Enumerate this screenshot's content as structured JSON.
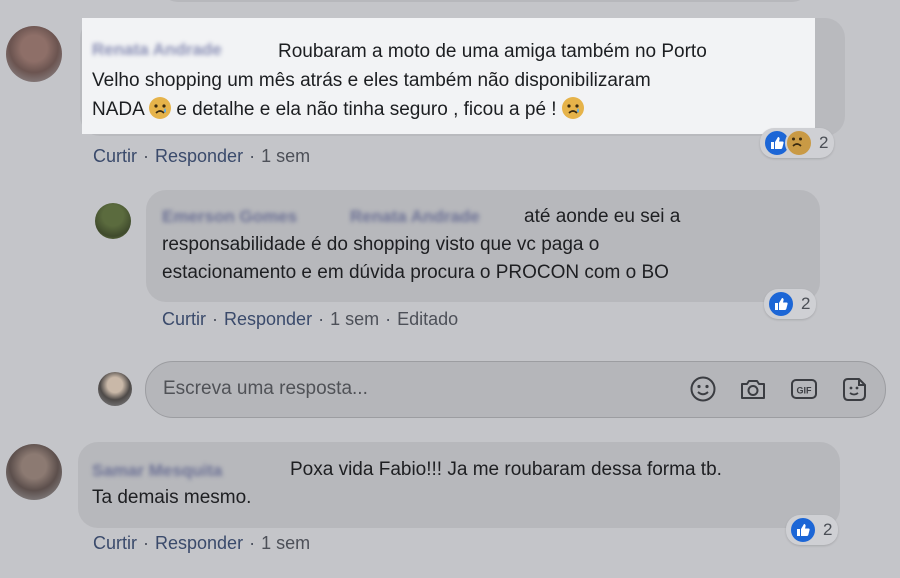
{
  "comments": [
    {
      "author": "Renata Andrade",
      "text_line1": "Roubaram a moto de uma amiga também no Porto",
      "text_line2": "Velho shopping um mês atrás e eles também não disponibilizaram",
      "text_line3a": "NADA",
      "text_line3b": "e detalhe e ela não tinha seguro , ficou a pé !",
      "actions": {
        "like": "Curtir",
        "reply": "Responder",
        "time": "1 sem"
      },
      "reaction_count": "2"
    },
    {
      "author": "Emerson Gomes",
      "mention": "Renata Andrade",
      "text_line1": "até aonde eu sei a",
      "text_line2": "responsabilidade é do shopping visto que vc paga o",
      "text_line3": "estacionamento e em dúvida procura o PROCON com o BO",
      "actions": {
        "like": "Curtir",
        "reply": "Responder",
        "time": "1 sem",
        "edited": "Editado"
      },
      "reaction_count": "2"
    },
    {
      "author": "Samar Mesquita",
      "text_line1": "Poxa vida Fabio!!! Ja me roubaram dessa forma tb.",
      "text_line2": "Ta demais mesmo.",
      "actions": {
        "like": "Curtir",
        "reply": "Responder",
        "time": "1 sem"
      },
      "reaction_count": "2"
    }
  ],
  "reply_input": {
    "placeholder": "Escreva uma resposta..."
  },
  "sep": "·",
  "gif_label": "GIF",
  "colors": {
    "like_blue": "#1c66d6",
    "action_link": "#3a4a6b",
    "highlight_bg": "#f2f3f5"
  }
}
